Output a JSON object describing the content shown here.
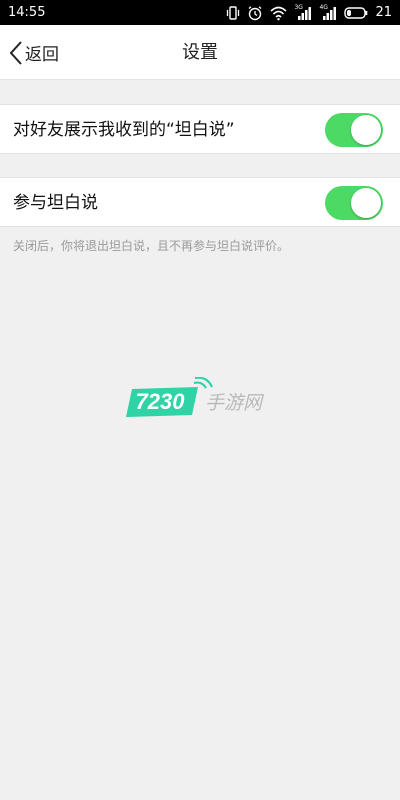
{
  "status_bar": {
    "time": "14:55",
    "network_1": "3G",
    "network_2": "4G",
    "battery": "21"
  },
  "nav": {
    "back_label": "返回",
    "title": "设置"
  },
  "settings": [
    {
      "label": "对好友展示我收到的“坦白说”",
      "enabled": true
    },
    {
      "label": "参与坦白说",
      "enabled": true
    }
  ],
  "hint": "关闭后，你将退出坦白说，且不再参与坦白说评价。",
  "watermark": {
    "number": "7230",
    "text": "手游网"
  },
  "colors": {
    "toggle_on": "#4cd964",
    "watermark_green": "#2fd3a6"
  }
}
